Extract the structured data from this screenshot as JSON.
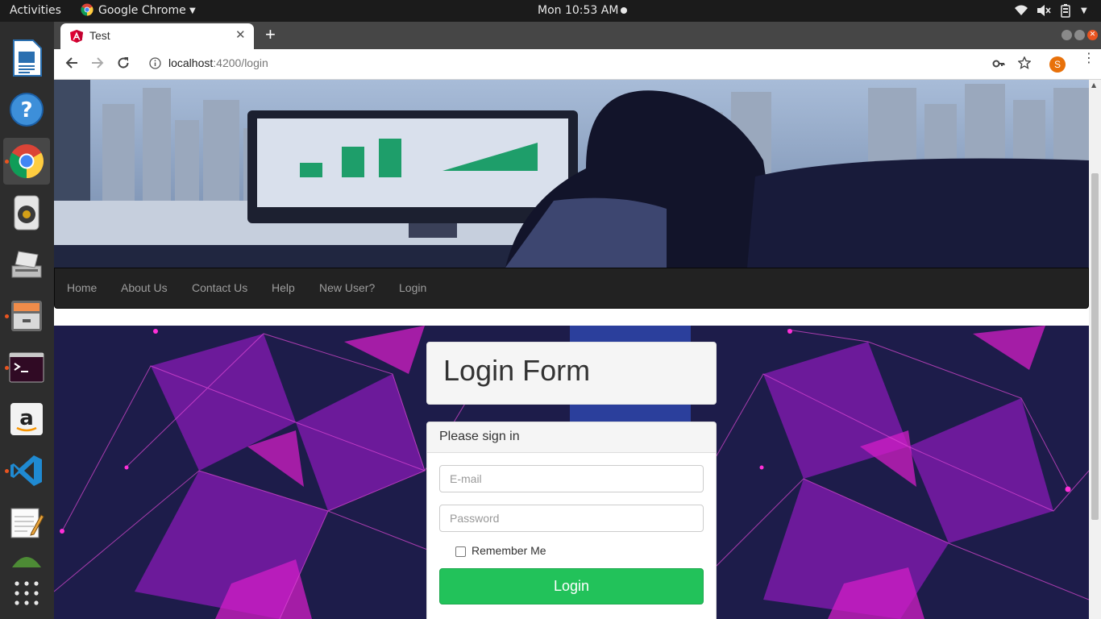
{
  "topbar": {
    "activities": "Activities",
    "app_name": "Google Chrome",
    "clock": "Mon 10:53 AM"
  },
  "dock": {
    "items": [
      "libreoffice-writer-icon",
      "help-icon",
      "chrome-icon",
      "speaker-icon",
      "scanner-icon",
      "file-cabinet-icon",
      "terminal-icon",
      "amazon-icon",
      "vscode-icon",
      "text-editor-icon",
      "app-icon",
      "show-apps-icon"
    ]
  },
  "browser": {
    "tab_title": "Test",
    "new_tab": "+",
    "url_host": "localhost",
    "url_path": ":4200/login",
    "profile_initial": "S"
  },
  "nav": {
    "items": [
      "Home",
      "About Us",
      "Contact Us",
      "Help",
      "New User?",
      "Login"
    ]
  },
  "login": {
    "title": "Login Form",
    "panel_heading": "Please sign in",
    "email_placeholder": "E-mail",
    "password_placeholder": "Password",
    "remember_label": "Remember Me",
    "submit_label": "Login"
  },
  "colors": {
    "submit": "#22c25a",
    "accent": "#e95420"
  }
}
